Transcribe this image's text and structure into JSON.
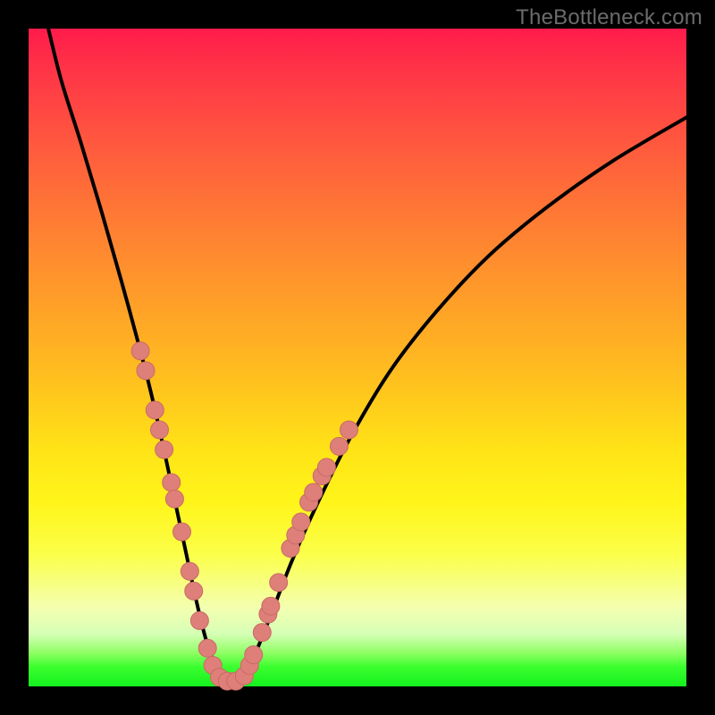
{
  "watermark": "TheBottleneck.com",
  "colors": {
    "frame": "#000000",
    "curve": "#000000",
    "marker_fill": "#de7f79",
    "marker_stroke": "#c96b65",
    "gradient_top": "#ff1b4b",
    "gradient_bottom": "#14f01e"
  },
  "chart_data": {
    "type": "line",
    "title": "",
    "xlabel": "",
    "ylabel": "",
    "xlim": [
      0,
      100
    ],
    "ylim": [
      0,
      100
    ],
    "grid": false,
    "legend": false,
    "series": [
      {
        "name": "bottleneck-curve",
        "x": [
          3,
          5,
          8,
          11,
          14,
          17,
          19,
          21,
          22.5,
          24,
          25.5,
          27,
          28.5,
          30,
          32,
          34,
          36.5,
          40,
          44,
          49,
          55,
          62,
          70,
          79,
          89,
          100
        ],
        "values": [
          100,
          92,
          82.5,
          72.5,
          62,
          51,
          43,
          34,
          27,
          20,
          13,
          7,
          3,
          0.8,
          0.8,
          4,
          10,
          19,
          28,
          38,
          48,
          57,
          65.5,
          73,
          80,
          86.5
        ]
      }
    ],
    "markers": [
      {
        "x": 17.0,
        "y": 51
      },
      {
        "x": 17.8,
        "y": 48
      },
      {
        "x": 19.2,
        "y": 42
      },
      {
        "x": 19.9,
        "y": 39
      },
      {
        "x": 20.6,
        "y": 36
      },
      {
        "x": 21.7,
        "y": 31
      },
      {
        "x": 22.2,
        "y": 28.5
      },
      {
        "x": 23.3,
        "y": 23.5
      },
      {
        "x": 24.5,
        "y": 17.5
      },
      {
        "x": 25.1,
        "y": 14.5
      },
      {
        "x": 26.0,
        "y": 10
      },
      {
        "x": 27.2,
        "y": 5.8
      },
      {
        "x": 28.0,
        "y": 3.2
      },
      {
        "x": 29.0,
        "y": 1.4
      },
      {
        "x": 30.2,
        "y": 0.8
      },
      {
        "x": 31.5,
        "y": 0.8
      },
      {
        "x": 32.8,
        "y": 1.6
      },
      {
        "x": 33.6,
        "y": 3.2
      },
      {
        "x": 34.2,
        "y": 4.8
      },
      {
        "x": 35.5,
        "y": 8.2
      },
      {
        "x": 36.4,
        "y": 11
      },
      {
        "x": 36.8,
        "y": 12.2
      },
      {
        "x": 38.0,
        "y": 15.8
      },
      {
        "x": 39.8,
        "y": 21
      },
      {
        "x": 40.6,
        "y": 23
      },
      {
        "x": 41.4,
        "y": 25
      },
      {
        "x": 42.6,
        "y": 28
      },
      {
        "x": 43.3,
        "y": 29.5
      },
      {
        "x": 44.6,
        "y": 32
      },
      {
        "x": 45.3,
        "y": 33.3
      },
      {
        "x": 47.2,
        "y": 36.5
      },
      {
        "x": 48.7,
        "y": 39
      }
    ],
    "marker_radius_px": 10
  }
}
